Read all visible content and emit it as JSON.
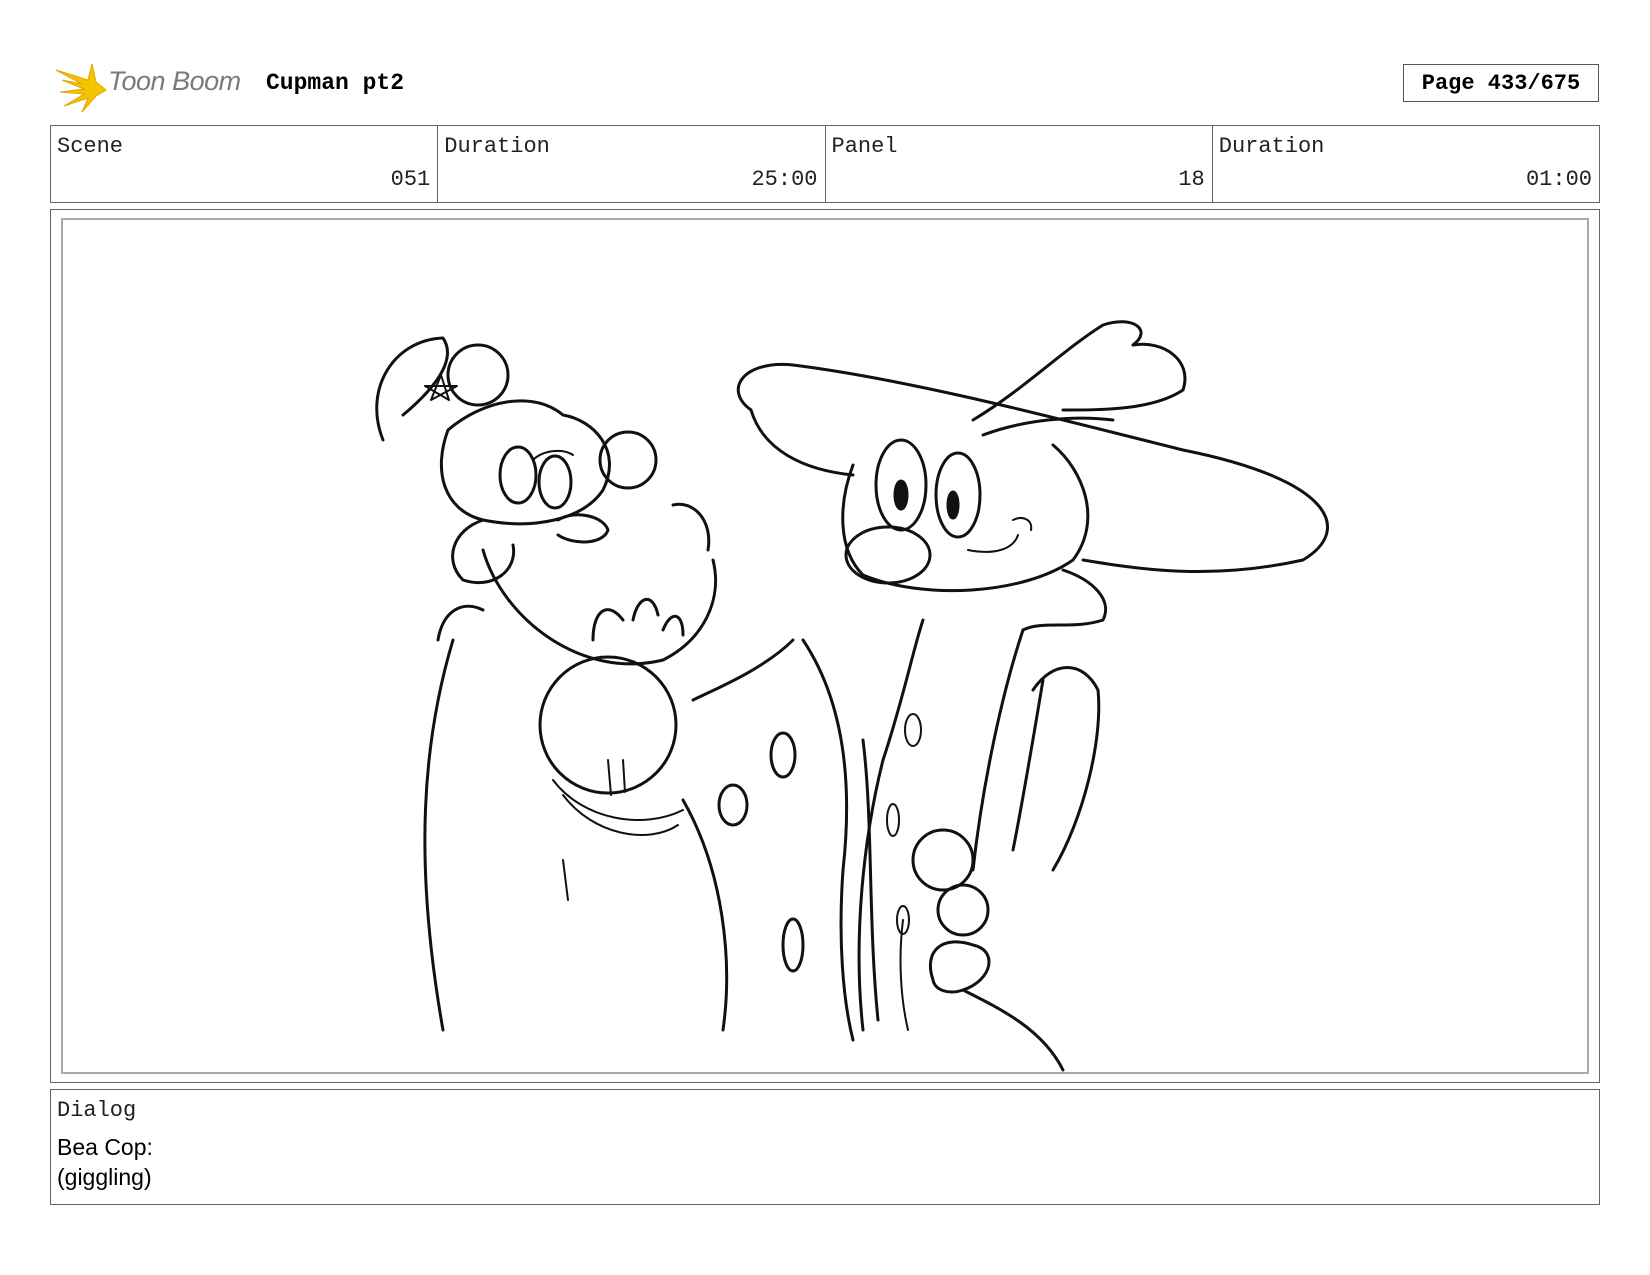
{
  "header": {
    "logo_text": "Toon Boom",
    "project_title": "Cupman pt2",
    "page_number": "Page 433/675"
  },
  "info": {
    "scene_label": "Scene",
    "scene_value": "051",
    "scene_duration_label": "Duration",
    "scene_duration_value": "25:00",
    "panel_label": "Panel",
    "panel_value": "18",
    "panel_duration_label": "Duration",
    "panel_duration_value": "01:00"
  },
  "dialog": {
    "label": "Dialog",
    "lines": [
      "Bea Cop:",
      "(giggling)"
    ]
  },
  "colors": {
    "logo_star": "#f5c400",
    "logo_text": "#7a7a7a",
    "border": "#666666"
  }
}
